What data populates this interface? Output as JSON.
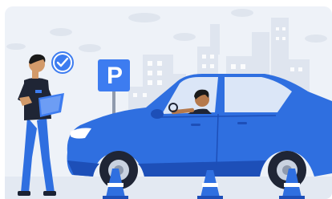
{
  "illustration": {
    "sign_letter": "P",
    "icons": {
      "checkmark": "check-circle-icon",
      "sign": "parking-sign-icon"
    },
    "colors": {
      "background": "#eef2f8",
      "city": "#dde4ef",
      "car": "#2f6fe0",
      "car_dark": "#1d4fb8",
      "accent": "#3d7cf0",
      "cone": "#2f6fe0",
      "road": "#cfd7e6"
    }
  }
}
